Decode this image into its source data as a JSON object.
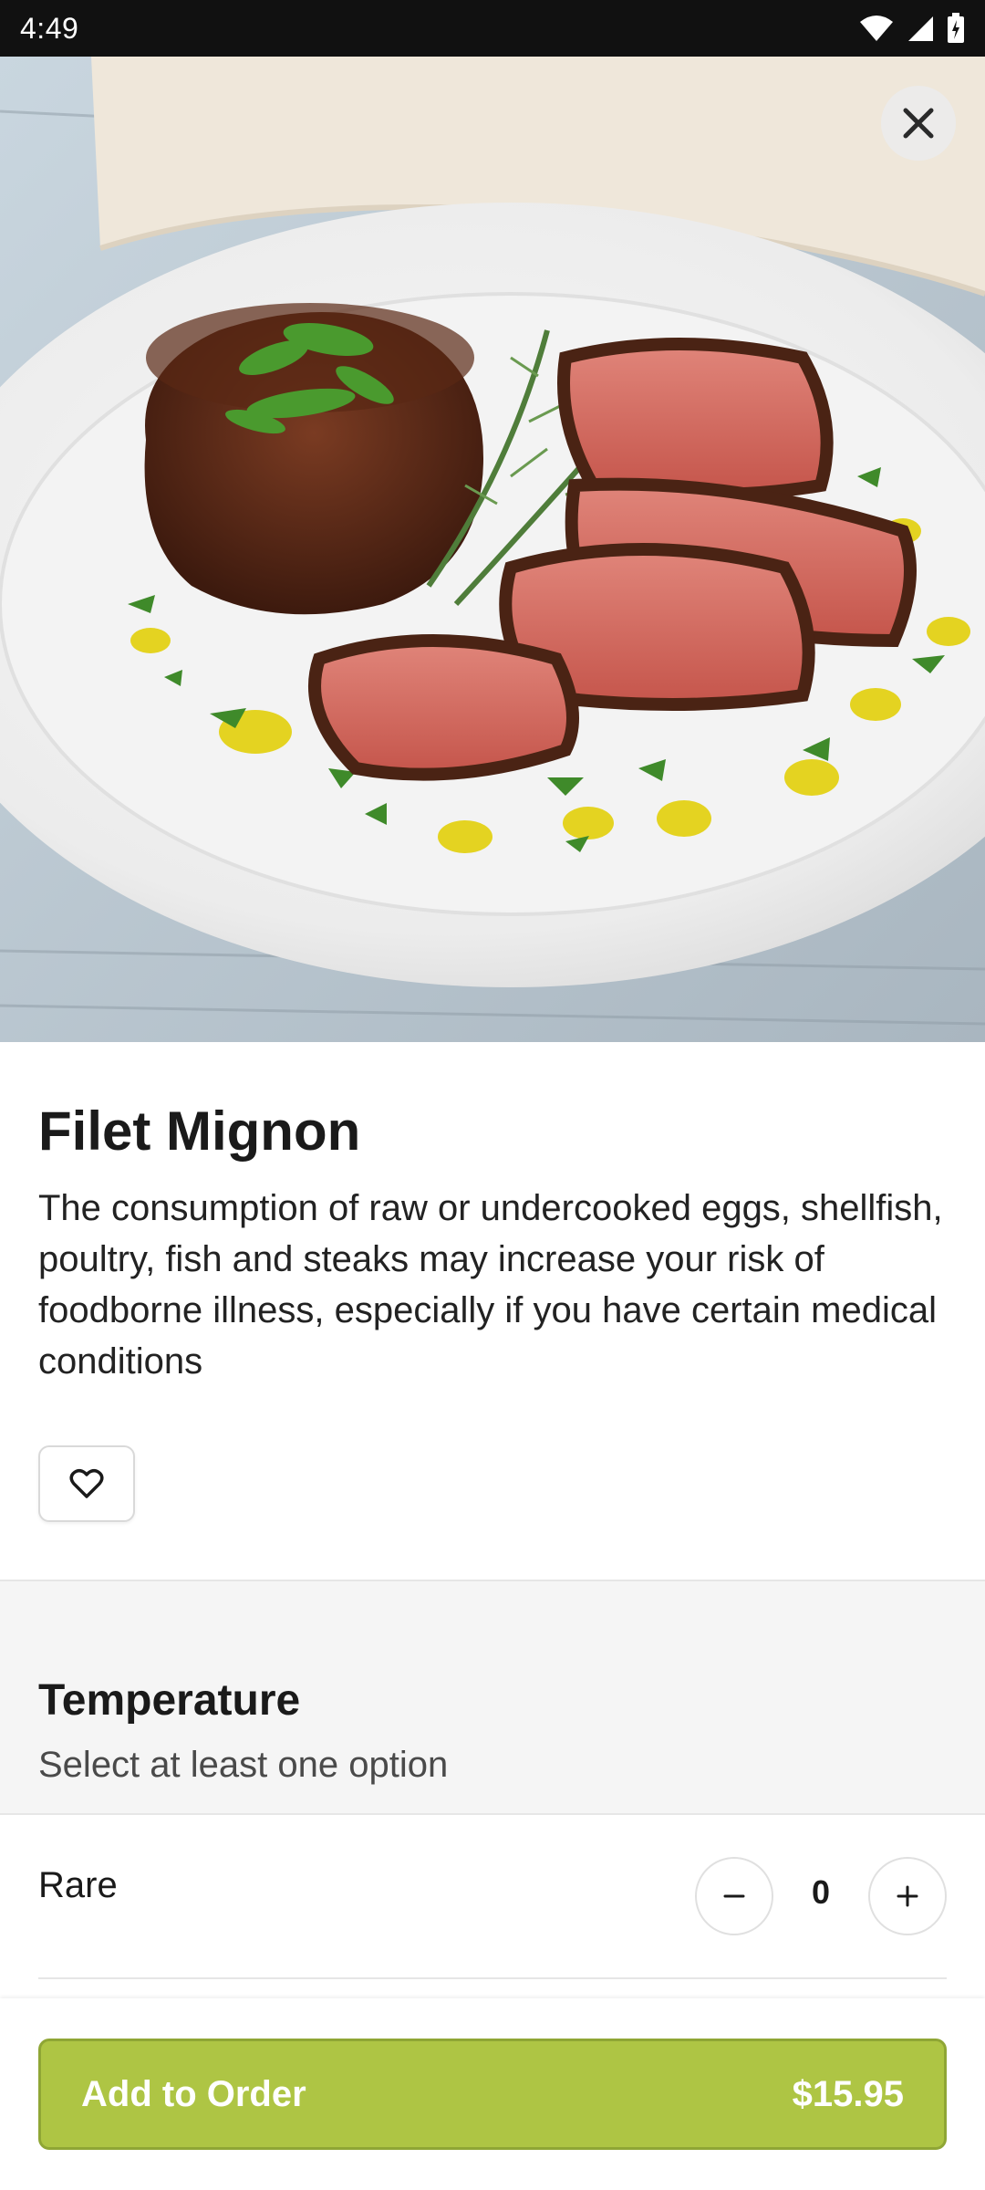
{
  "status_bar": {
    "time": "4:49",
    "icons": [
      "wifi-icon",
      "signal-icon",
      "battery-icon"
    ]
  },
  "hero": {
    "image": "filet-mignon-photo",
    "close_icon": "close-icon"
  },
  "item": {
    "title": "Filet Mignon",
    "description": "The consumption of raw or undercooked eggs, shellfish, poultry, fish and steaks may increase your risk of foodborne illness, especially if you have certain medical conditions",
    "favorite_icon": "heart-icon"
  },
  "modifier_group": {
    "title": "Temperature",
    "subtitle": "Select at least one option",
    "options": [
      {
        "label": "Rare",
        "quantity": "0"
      }
    ]
  },
  "order": {
    "button_label": "Add to Order",
    "price": "$15.95"
  },
  "colors": {
    "accent": "#aec544",
    "status_bar": "#111111",
    "section_bg": "#f5f5f5"
  }
}
